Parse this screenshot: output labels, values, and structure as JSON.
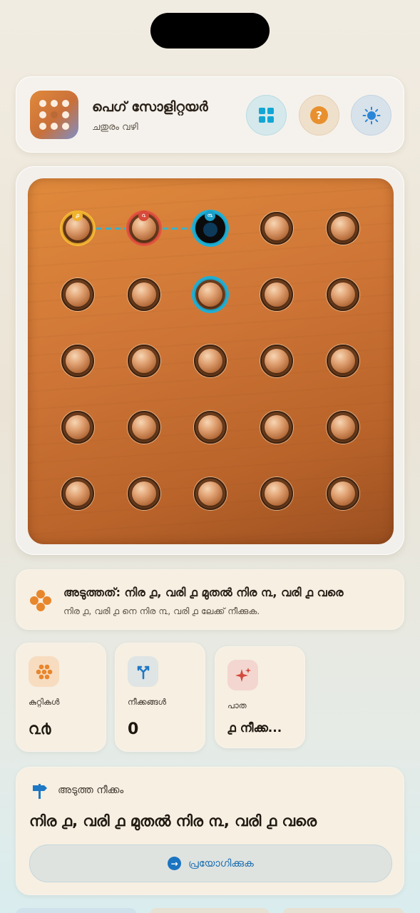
{
  "app": {
    "title": "പെഗ് സോളിറ്റയർ",
    "subtitle": "ചതുരം വഴി"
  },
  "header_buttons": [
    {
      "name": "layout",
      "icon": "grid-icon"
    },
    {
      "name": "help",
      "icon": "help-icon",
      "glyph": "?"
    },
    {
      "name": "theme",
      "icon": "sun-icon"
    }
  ],
  "board": {
    "rows": 5,
    "cols": 5,
    "pegs": [
      [
        1,
        1,
        0,
        1,
        1
      ],
      [
        1,
        1,
        1,
        1,
        1
      ],
      [
        1,
        1,
        1,
        1,
        1
      ],
      [
        1,
        1,
        1,
        1,
        1
      ],
      [
        1,
        1,
        1,
        1,
        1
      ]
    ],
    "highlight": {
      "source": {
        "row": 0,
        "col": 0,
        "badge": "൧"
      },
      "jumped": {
        "row": 0,
        "col": 1,
        "badge": "൨"
      },
      "target": {
        "row": 0,
        "col": 2,
        "badge": "൩"
      },
      "alternate": {
        "row": 1,
        "col": 2
      }
    },
    "colors": {
      "source": "#f1b22e",
      "jumped": "#d84a3a",
      "target": "#1a9ec8"
    }
  },
  "hint": {
    "title": "അടുത്തത്: നിര ൧, വരി ൧ മുതൽ നിര ൩, വരി ൧ വരെ",
    "subtitle": "നിര ൧, വരി ൧ നെ നിര ൩, വരി ൧ ലേക്ക് നീക്കുക."
  },
  "stats": [
    {
      "label": "കുറ്റികൾ",
      "value": "൨൪",
      "icon": "pegs-icon",
      "bg": "#f7dcc0"
    },
    {
      "label": "നീക്കങ്ങൾ",
      "value": "0",
      "icon": "branch-icon",
      "bg": "#dfe4e4"
    },
    {
      "label": "പാത",
      "value": "൧ നീക്ക...",
      "icon": "sparkle-icon",
      "bg": "#f3d6cf"
    }
  ],
  "next_move": {
    "label": "അടുത്ത നീക്കം",
    "move": "നിര ൧, വരി ൧ മുതൽ നിര ൩, വരി ൧ വരെ",
    "apply_label": "പ്രയോഗിക്കുക"
  }
}
